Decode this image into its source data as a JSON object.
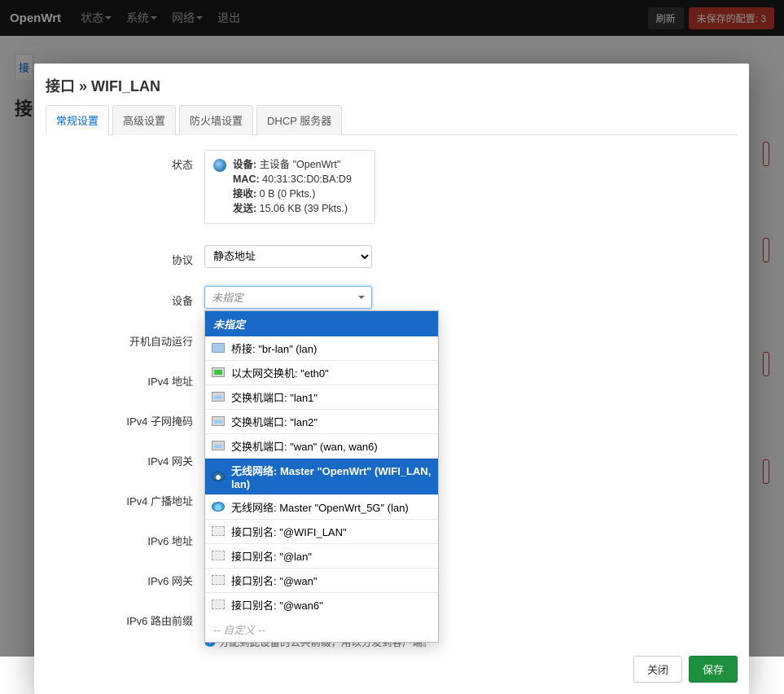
{
  "top": {
    "brand": "OpenWrt",
    "nav": [
      "状态",
      "系统",
      "网络",
      "退出"
    ],
    "refresh": "刷新",
    "unsaved_prefix": "未保存的配置: ",
    "unsaved_count": "3"
  },
  "bg": {
    "tab": "接",
    "heading": "接"
  },
  "modal": {
    "title": "接口 » WIFI_LAN",
    "tabs": [
      "常规设置",
      "高级设置",
      "防火墙设置",
      "DHCP 服务器"
    ],
    "close": "关闭",
    "save": "保存"
  },
  "labels": {
    "status": "状态",
    "protocol": "协议",
    "device": "设备",
    "autorun": "开机自动运行",
    "ipv4addr": "IPv4 地址",
    "ipv4mask": "IPv4 子网掩码",
    "ipv4gw": "IPv4 网关",
    "ipv4bcast": "IPv4 广播地址",
    "ipv6addr": "IPv6 地址",
    "ipv6gw": "IPv6 网关",
    "ipv6prefix": "IPv6 路由前缀"
  },
  "status": {
    "device_k": "设备:",
    "device_v": " 主设备 \"OpenWrt\"",
    "mac_k": "MAC:",
    "mac_v": " 40:31:3C:D0:BA:D9",
    "rx_k": "接收:",
    "rx_v": " 0 B (0 Pkts.)",
    "tx_k": "发送:",
    "tx_v": " 15.06 KB (39 Pkts.)"
  },
  "protocol": {
    "selected": "静态地址"
  },
  "device": {
    "placeholder": "未指定",
    "dropdown_header": "未指定",
    "options": [
      {
        "icon": "bridge",
        "text": "桥接: \"br-lan\" (lan)"
      },
      {
        "icon": "eth",
        "text": "以太网交换机: \"eth0\""
      },
      {
        "icon": "port",
        "text": "交换机端口: \"lan1\""
      },
      {
        "icon": "port",
        "text": "交换机端口: \"lan2\""
      },
      {
        "icon": "port",
        "text": "交换机端口: \"wan\" (wan, wan6)"
      },
      {
        "icon": "wifi-sel",
        "text": "无线网络: Master \"OpenWrt\" (WIFI_LAN, lan)",
        "selected": true
      },
      {
        "icon": "wifi",
        "text": "无线网络: Master \"OpenWrt_5G\" (lan)"
      },
      {
        "icon": "alias",
        "text": "接口别名: \"@WIFI_LAN\""
      },
      {
        "icon": "alias",
        "text": "接口别名: \"@lan\""
      },
      {
        "icon": "alias",
        "text": "接口别名: \"@wan\""
      },
      {
        "icon": "alias",
        "text": "接口别名: \"@wan6\""
      }
    ],
    "custom": "-- 自定义 --"
  },
  "help": {
    "ipv6prefix": "分配到此设备的公共前缀，用以分发到客户端。"
  }
}
